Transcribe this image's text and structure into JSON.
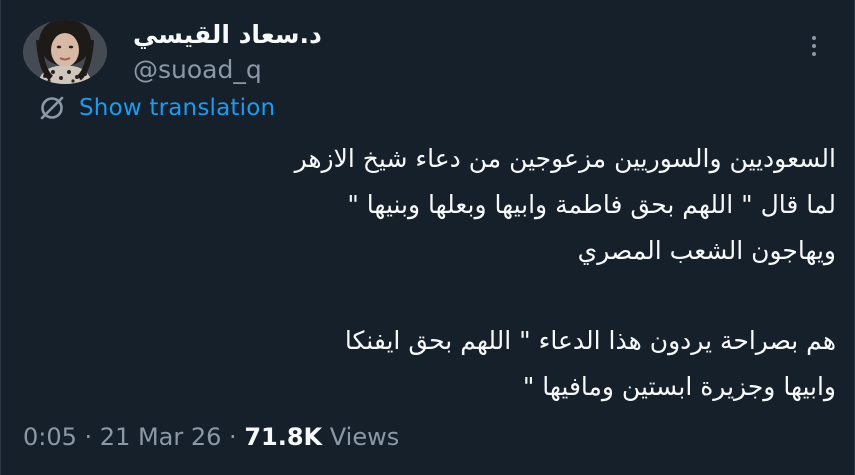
{
  "tweet": {
    "author": {
      "display_name": "د.سعاد القيسي",
      "handle": "@suoad_q",
      "avatar_icon": "profile-photo"
    },
    "more_icon": "more-vertical-icon",
    "translate": {
      "label": "Show translation",
      "icon": "globe-slash-icon"
    },
    "text_lines": [
      "السعوديين والسوريين مزعوجين من دعاء شيخ الازهر",
      "لما قال \" اللهم بحق فاطمة وابيها وبعلها وبنيها \"",
      "ويهاجون الشعب المصري",
      "هم بصراحة يردون هذا الدعاء \" اللهم بحق ايفنكا",
      "وابيها وجزيرة ابستين ومافيها \""
    ],
    "meta": {
      "time": "0:05",
      "date": "21 Mar 26",
      "separator": " · ",
      "views_count": "71.8K",
      "views_label": "Views"
    },
    "colors": {
      "background": "#15202b",
      "text": "#f7f9f9",
      "secondary": "#8b98a5",
      "link": "#1d9bf0"
    }
  }
}
